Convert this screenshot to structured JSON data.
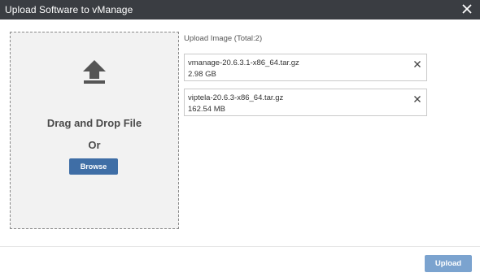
{
  "dialog": {
    "title": "Upload Software to vManage",
    "close_icon": "close-icon"
  },
  "dropzone": {
    "icon": "upload-icon",
    "instruction": "Drag and Drop File",
    "or_text": "Or",
    "browse_label": "Browse"
  },
  "file_list": {
    "heading": "Upload Image (Total:2)",
    "files": [
      {
        "name": "vmanage-20.6.3.1-x86_64.tar.gz",
        "size": "2.98 GB"
      },
      {
        "name": "viptela-20.6.3-x86_64.tar.gz",
        "size": "162.54 MB"
      }
    ],
    "remove_icon": "remove-icon"
  },
  "footer": {
    "upload_label": "Upload"
  },
  "colors": {
    "titlebar": "#3a3d42",
    "primary": "#3f6ea6",
    "upload_button": "#7ba3cf"
  }
}
